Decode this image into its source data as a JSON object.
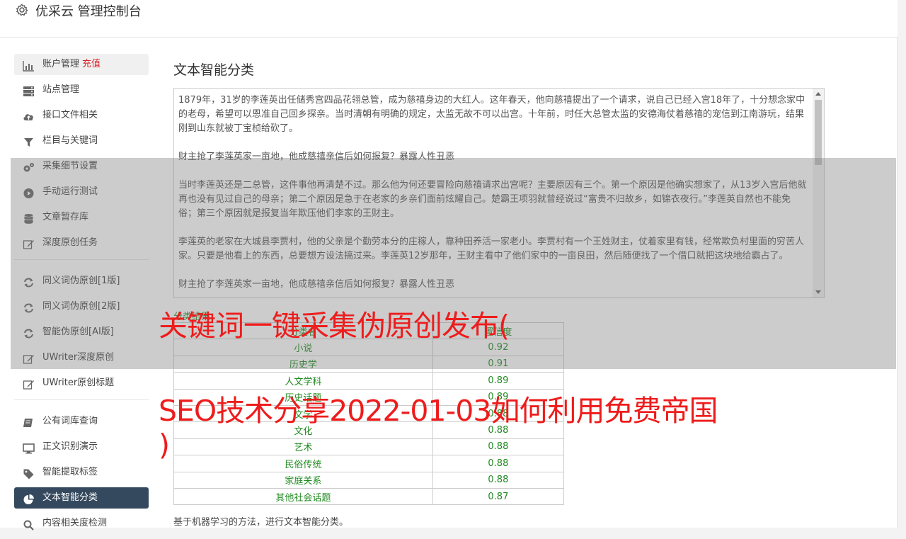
{
  "header": {
    "title": "优采云 管理控制台",
    "icon": "gear-icon"
  },
  "sidebar": {
    "group1": [
      {
        "label": "账户管理",
        "badge": "充值",
        "icon": "bar-chart-icon"
      },
      {
        "label": "站点管理",
        "icon": "server-icon"
      },
      {
        "label": "接口文件相关",
        "icon": "cloud-upload-icon"
      },
      {
        "label": "栏目与关键词",
        "icon": "filter-icon"
      },
      {
        "label": "采集细节设置",
        "icon": "gears-icon"
      },
      {
        "label": "手动运行测试",
        "icon": "play-circle-icon"
      },
      {
        "label": "文章暂存库",
        "icon": "database-icon"
      },
      {
        "label": "深度原创任务",
        "icon": "edit-icon"
      }
    ],
    "group2": [
      {
        "label": "同义词伪原创[1版]",
        "icon": "refresh-icon"
      },
      {
        "label": "同义词伪原创[2版]",
        "icon": "refresh-icon"
      },
      {
        "label": "智能伪原创[AI版]",
        "icon": "refresh-icon"
      },
      {
        "label": "UWriter深度原创",
        "icon": "edit-icon"
      },
      {
        "label": "UWriter原创标题",
        "icon": "edit-icon"
      }
    ],
    "group3": [
      {
        "label": "公有词库查询",
        "icon": "book-icon"
      },
      {
        "label": "正文识别演示",
        "icon": "desktop-icon"
      },
      {
        "label": "智能提取标签",
        "icon": "tag-icon"
      },
      {
        "label": "文本智能分类",
        "icon": "pie-chart-icon"
      },
      {
        "label": "内容相关度检测",
        "icon": "search-icon"
      }
    ]
  },
  "main": {
    "title": "文本智能分类",
    "paragraphs": [
      "1879年，31岁的李莲英出任储秀宫四品花翎总管，成为慈禧身边的大红人。这年春天，他向慈禧提出了一个请求，说自己已经入宫18年了，十分想念家中的老母，希望可以恩准自己回乡探亲。当时清朝有明确的规定，太监无故不可以出宫。十年前，时任大总管太监的安德海仗着慈禧的宠信到江南游玩，结果刚到山东就被丁宝桢给砍了。",
      "财主抢了李莲英家一亩地，他成慈禧亲信后如何报复？暴露人性丑恶",
      "当时李莲英还是二总管，这件事他再清楚不过。那么他为何还要冒险向慈禧请求出宫呢？主要原因有三个。第一个原因是他确实想家了，从13岁入宫后他就再也没有见过自己的母亲；第二个原因是急于在老家的乡亲们面前炫耀自己。楚霸王项羽就曾经说过“富贵不归故乡，如锦衣夜行。”李莲英自然也不能免俗；第三个原因就是报复当年欺压他们李家的王财主。",
      "李莲英的老家在大城县李贾村，他的父亲是个勤劳本分的庄稼人，靠种田养活一家老小。李贾村有一个王姓财主，仗着家里有钱，经常欺负村里面的穷苦人家。只要是他看上的东西，总要想方设法搞过来。李莲英12岁那年，王财主看中了他们家中的一亩良田，然后随便找了一个借口就把这块地给霸占了。",
      "财主抢了李莲英家一亩地，他成慈禧亲信后如何报复？暴露人性丑恶"
    ],
    "results_label": "分类结果：",
    "table_headers": [
      "分类名",
      "置信度"
    ],
    "table_rows": [
      [
        "小说",
        "0.92"
      ],
      [
        "历史学",
        "0.91"
      ],
      [
        "人文学科",
        "0.89"
      ],
      [
        "历史话题",
        "0.89"
      ],
      [
        "文学",
        "0.88"
      ],
      [
        "文化",
        "0.88"
      ],
      [
        "艺术",
        "0.88"
      ],
      [
        "民俗传统",
        "0.88"
      ],
      [
        "家庭关系",
        "0.88"
      ],
      [
        "其他社会话题",
        "0.87"
      ]
    ],
    "description": "基于机器学习的方法，进行文本智能分类。"
  },
  "overlay": {
    "line1": "关键词一键采集伪原创发布(",
    "line2": "SEO技术分享2022-01-03如何利用免费帝国",
    "line3": ")",
    "color": "#ee1c1c"
  }
}
